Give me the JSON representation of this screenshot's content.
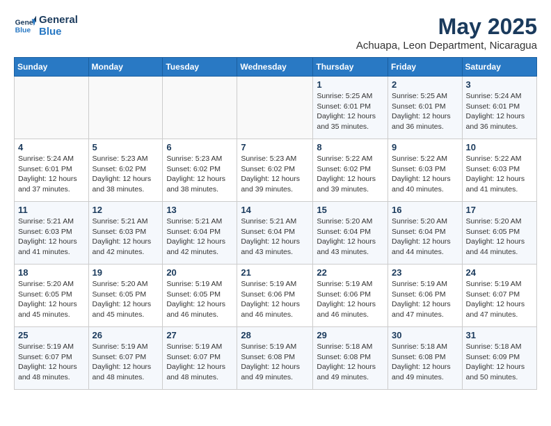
{
  "logo": {
    "line1": "General",
    "line2": "Blue"
  },
  "title": "May 2025",
  "location": "Achuapa, Leon Department, Nicaragua",
  "days_of_week": [
    "Sunday",
    "Monday",
    "Tuesday",
    "Wednesday",
    "Thursday",
    "Friday",
    "Saturday"
  ],
  "weeks": [
    [
      {
        "day": "",
        "info": ""
      },
      {
        "day": "",
        "info": ""
      },
      {
        "day": "",
        "info": ""
      },
      {
        "day": "",
        "info": ""
      },
      {
        "day": "1",
        "info": "Sunrise: 5:25 AM\nSunset: 6:01 PM\nDaylight: 12 hours\nand 35 minutes."
      },
      {
        "day": "2",
        "info": "Sunrise: 5:25 AM\nSunset: 6:01 PM\nDaylight: 12 hours\nand 36 minutes."
      },
      {
        "day": "3",
        "info": "Sunrise: 5:24 AM\nSunset: 6:01 PM\nDaylight: 12 hours\nand 36 minutes."
      }
    ],
    [
      {
        "day": "4",
        "info": "Sunrise: 5:24 AM\nSunset: 6:01 PM\nDaylight: 12 hours\nand 37 minutes."
      },
      {
        "day": "5",
        "info": "Sunrise: 5:23 AM\nSunset: 6:02 PM\nDaylight: 12 hours\nand 38 minutes."
      },
      {
        "day": "6",
        "info": "Sunrise: 5:23 AM\nSunset: 6:02 PM\nDaylight: 12 hours\nand 38 minutes."
      },
      {
        "day": "7",
        "info": "Sunrise: 5:23 AM\nSunset: 6:02 PM\nDaylight: 12 hours\nand 39 minutes."
      },
      {
        "day": "8",
        "info": "Sunrise: 5:22 AM\nSunset: 6:02 PM\nDaylight: 12 hours\nand 39 minutes."
      },
      {
        "day": "9",
        "info": "Sunrise: 5:22 AM\nSunset: 6:03 PM\nDaylight: 12 hours\nand 40 minutes."
      },
      {
        "day": "10",
        "info": "Sunrise: 5:22 AM\nSunset: 6:03 PM\nDaylight: 12 hours\nand 41 minutes."
      }
    ],
    [
      {
        "day": "11",
        "info": "Sunrise: 5:21 AM\nSunset: 6:03 PM\nDaylight: 12 hours\nand 41 minutes."
      },
      {
        "day": "12",
        "info": "Sunrise: 5:21 AM\nSunset: 6:03 PM\nDaylight: 12 hours\nand 42 minutes."
      },
      {
        "day": "13",
        "info": "Sunrise: 5:21 AM\nSunset: 6:04 PM\nDaylight: 12 hours\nand 42 minutes."
      },
      {
        "day": "14",
        "info": "Sunrise: 5:21 AM\nSunset: 6:04 PM\nDaylight: 12 hours\nand 43 minutes."
      },
      {
        "day": "15",
        "info": "Sunrise: 5:20 AM\nSunset: 6:04 PM\nDaylight: 12 hours\nand 43 minutes."
      },
      {
        "day": "16",
        "info": "Sunrise: 5:20 AM\nSunset: 6:04 PM\nDaylight: 12 hours\nand 44 minutes."
      },
      {
        "day": "17",
        "info": "Sunrise: 5:20 AM\nSunset: 6:05 PM\nDaylight: 12 hours\nand 44 minutes."
      }
    ],
    [
      {
        "day": "18",
        "info": "Sunrise: 5:20 AM\nSunset: 6:05 PM\nDaylight: 12 hours\nand 45 minutes."
      },
      {
        "day": "19",
        "info": "Sunrise: 5:20 AM\nSunset: 6:05 PM\nDaylight: 12 hours\nand 45 minutes."
      },
      {
        "day": "20",
        "info": "Sunrise: 5:19 AM\nSunset: 6:05 PM\nDaylight: 12 hours\nand 46 minutes."
      },
      {
        "day": "21",
        "info": "Sunrise: 5:19 AM\nSunset: 6:06 PM\nDaylight: 12 hours\nand 46 minutes."
      },
      {
        "day": "22",
        "info": "Sunrise: 5:19 AM\nSunset: 6:06 PM\nDaylight: 12 hours\nand 46 minutes."
      },
      {
        "day": "23",
        "info": "Sunrise: 5:19 AM\nSunset: 6:06 PM\nDaylight: 12 hours\nand 47 minutes."
      },
      {
        "day": "24",
        "info": "Sunrise: 5:19 AM\nSunset: 6:07 PM\nDaylight: 12 hours\nand 47 minutes."
      }
    ],
    [
      {
        "day": "25",
        "info": "Sunrise: 5:19 AM\nSunset: 6:07 PM\nDaylight: 12 hours\nand 48 minutes."
      },
      {
        "day": "26",
        "info": "Sunrise: 5:19 AM\nSunset: 6:07 PM\nDaylight: 12 hours\nand 48 minutes."
      },
      {
        "day": "27",
        "info": "Sunrise: 5:19 AM\nSunset: 6:07 PM\nDaylight: 12 hours\nand 48 minutes."
      },
      {
        "day": "28",
        "info": "Sunrise: 5:19 AM\nSunset: 6:08 PM\nDaylight: 12 hours\nand 49 minutes."
      },
      {
        "day": "29",
        "info": "Sunrise: 5:18 AM\nSunset: 6:08 PM\nDaylight: 12 hours\nand 49 minutes."
      },
      {
        "day": "30",
        "info": "Sunrise: 5:18 AM\nSunset: 6:08 PM\nDaylight: 12 hours\nand 49 minutes."
      },
      {
        "day": "31",
        "info": "Sunrise: 5:18 AM\nSunset: 6:09 PM\nDaylight: 12 hours\nand 50 minutes."
      }
    ]
  ]
}
